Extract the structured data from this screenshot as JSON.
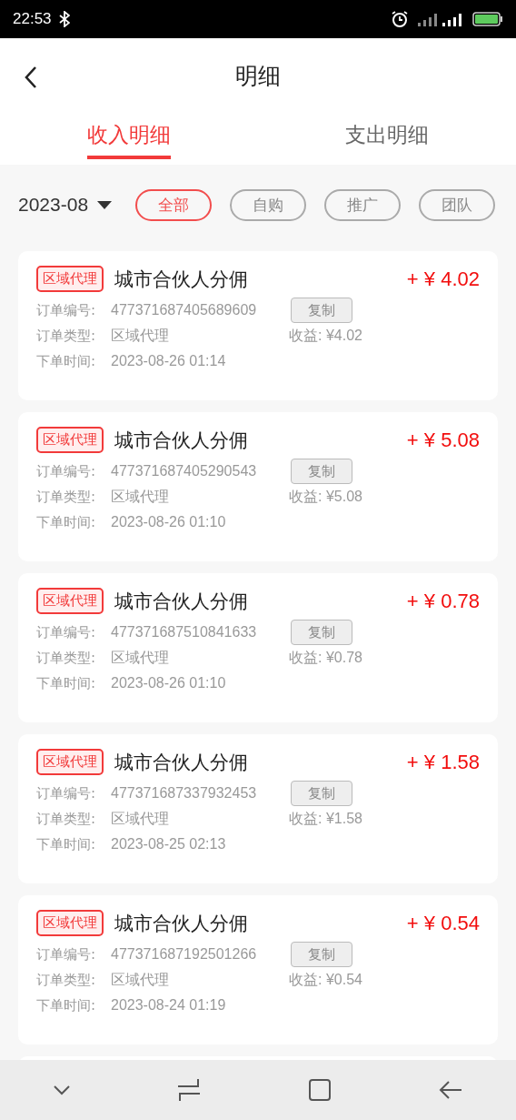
{
  "status_bar": {
    "time": "22:53"
  },
  "header": {
    "title": "明细"
  },
  "tabs": [
    {
      "label": "收入明细",
      "selected": true
    },
    {
      "label": "支出明细",
      "selected": false
    }
  ],
  "month": "2023-08",
  "filters": [
    {
      "label": "全部",
      "selected": true
    },
    {
      "label": "自购",
      "selected": false
    },
    {
      "label": "推广",
      "selected": false
    },
    {
      "label": "团队",
      "selected": false
    }
  ],
  "records": [
    {
      "tag": "区域代理",
      "title": "城市合伙人分佣",
      "amount": "+ ¥ 4.02",
      "order_no_label": "订单编号:",
      "order_no": "477371687405689609",
      "copy": "复制",
      "type_label": "订单类型:",
      "type": "区域代理",
      "income": "收益: ¥4.02",
      "time_label": "下单时间:",
      "time": "2023-08-26 01:14"
    },
    {
      "tag": "区域代理",
      "title": "城市合伙人分佣",
      "amount": "+ ¥ 5.08",
      "order_no_label": "订单编号:",
      "order_no": "477371687405290543",
      "copy": "复制",
      "type_label": "订单类型:",
      "type": "区域代理",
      "income": "收益: ¥5.08",
      "time_label": "下单时间:",
      "time": "2023-08-26 01:10"
    },
    {
      "tag": "区域代理",
      "title": "城市合伙人分佣",
      "amount": "+ ¥ 0.78",
      "order_no_label": "订单编号:",
      "order_no": "477371687510841633",
      "copy": "复制",
      "type_label": "订单类型:",
      "type": "区域代理",
      "income": "收益: ¥0.78",
      "time_label": "下单时间:",
      "time": "2023-08-26 01:10"
    },
    {
      "tag": "区域代理",
      "title": "城市合伙人分佣",
      "amount": "+ ¥ 1.58",
      "order_no_label": "订单编号:",
      "order_no": "477371687337932453",
      "copy": "复制",
      "type_label": "订单类型:",
      "type": "区域代理",
      "income": "收益: ¥1.58",
      "time_label": "下单时间:",
      "time": "2023-08-25 02:13"
    },
    {
      "tag": "区域代理",
      "title": "城市合伙人分佣",
      "amount": "+ ¥ 0.54",
      "order_no_label": "订单编号:",
      "order_no": "477371687192501266",
      "copy": "复制",
      "type_label": "订单类型:",
      "type": "区域代理",
      "income": "收益: ¥0.54",
      "time_label": "下单时间:",
      "time": "2023-08-24 01:19"
    }
  ]
}
